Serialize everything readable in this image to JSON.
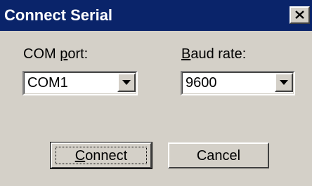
{
  "dialog": {
    "title": "Connect Serial",
    "close_icon": "close-icon"
  },
  "com_port": {
    "label_prefix": "COM ",
    "label_accel": "p",
    "label_suffix": "ort:",
    "value": "COM1",
    "dropdown_icon": "chevron-down-icon"
  },
  "baud_rate": {
    "label_accel": "B",
    "label_suffix": "aud rate:",
    "value": "9600",
    "dropdown_icon": "chevron-down-icon"
  },
  "buttons": {
    "connect_accel": "C",
    "connect_suffix": "onnect",
    "cancel_label": "Cancel"
  },
  "colors": {
    "titlebar": "#0a246a",
    "face": "#d4d0c8"
  }
}
